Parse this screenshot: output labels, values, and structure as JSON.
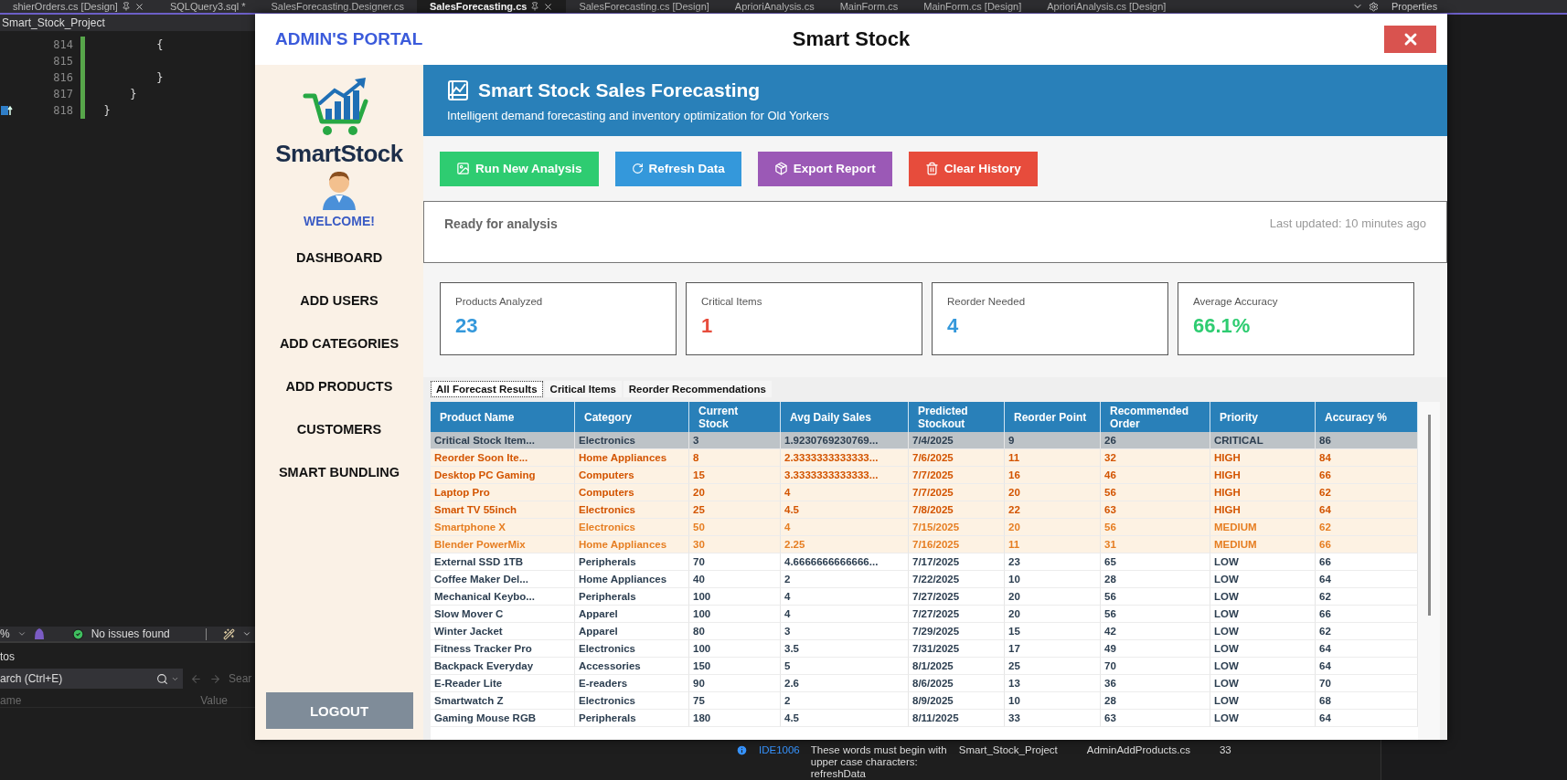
{
  "ide": {
    "tabs": [
      {
        "label": "shierOrders.cs [Design]",
        "selected": false,
        "pinned": true
      },
      {
        "label": "SQLQuery3.sql *",
        "selected": false,
        "pinned": false
      },
      {
        "label": "SalesForecasting.Designer.cs",
        "selected": false,
        "pinned": false
      },
      {
        "label": "SalesForecasting.cs",
        "selected": true,
        "pinned": true
      },
      {
        "label": "SalesForecasting.cs [Design]",
        "selected": false,
        "pinned": false
      },
      {
        "label": "AprioriAnalysis.cs",
        "selected": false,
        "pinned": false
      },
      {
        "label": "MainForm.cs",
        "selected": false,
        "pinned": false
      },
      {
        "label": "MainForm.cs [Design]",
        "selected": false,
        "pinned": false
      },
      {
        "label": "AprioriAnalysis.cs [Design]",
        "selected": false,
        "pinned": false
      }
    ],
    "panel_title": "Properties",
    "project": "Smart_Stock_Project",
    "code_lines": [
      {
        "number": "814",
        "text": "          {",
        "marker": false
      },
      {
        "number": "815",
        "marker": false
      },
      {
        "number": "816",
        "text": "          }",
        "marker": false
      },
      {
        "number": "817",
        "text": "      }",
        "marker": false
      },
      {
        "number": "818",
        "text": "  }",
        "marker": true
      }
    ],
    "status_bar": {
      "zoom": "%",
      "issues": "No issues found"
    },
    "locals": {
      "title": "tos",
      "search_placeholder": "arch (Ctrl+E)",
      "nav_hint": "Sear",
      "columns": [
        "ame",
        "Value"
      ]
    },
    "error_list": [
      {
        "code": "IDE1006",
        "description": "These words must begin with upper case characters: refreshData",
        "project": "Smart_Stock_Project",
        "file": "AdminAddProducts.cs",
        "line": "33"
      }
    ]
  },
  "app": {
    "portal_title": "ADMIN'S PORTAL",
    "title": "Smart Stock",
    "sidebar": {
      "brand": "SmartStock",
      "welcome": "WELCOME!",
      "items": [
        "DASHBOARD",
        "ADD USERS",
        "ADD CATEGORIES",
        "ADD PRODUCTS",
        "CUSTOMERS",
        "SMART BUNDLING"
      ],
      "logout": "LOGOUT"
    },
    "header": {
      "title": "Smart Stock Sales Forecasting",
      "subtitle": "Intelligent demand forecasting and inventory optimization for Old Yorkers"
    },
    "actions": [
      {
        "label": "Run New Analysis",
        "color": "#2ecc71"
      },
      {
        "label": "Refresh Data",
        "color": "#3498db"
      },
      {
        "label": "Export Report",
        "color": "#9b59b6"
      },
      {
        "label": "Clear History",
        "color": "#e74c3c"
      }
    ],
    "status": {
      "message": "Ready for analysis",
      "updated": "Last updated: 10 minutes ago"
    },
    "stats": [
      {
        "label": "Products Analyzed",
        "value": "23",
        "color": "#3498db"
      },
      {
        "label": "Critical Items",
        "value": "1",
        "color": "#e74c3c"
      },
      {
        "label": "Reorder Needed",
        "value": "4",
        "color": "#3498db"
      },
      {
        "label": "Average Accuracy",
        "value": "66.1%",
        "color": "#2ecc71"
      }
    ],
    "tabs": [
      {
        "label": "All Forecast Results",
        "selected": true
      },
      {
        "label": "Critical Items",
        "selected": false
      },
      {
        "label": "Reorder Recommendations",
        "selected": false
      }
    ],
    "table": {
      "columns": [
        "Product Name",
        "Category",
        "Current Stock",
        "Avg Daily Sales",
        "Predicted Stockout",
        "Reorder Point",
        "Recommended Order",
        "Priority",
        "Accuracy %"
      ],
      "rows": [
        {
          "kind": "critical",
          "selected": true,
          "cells": [
            "Critical Stock Item...",
            "Electronics",
            "3",
            "1.9230769230769...",
            "7/4/2025",
            "9",
            "26",
            "CRITICAL",
            "86"
          ]
        },
        {
          "kind": "high",
          "selected": false,
          "cells": [
            "Reorder Soon Ite...",
            "Home Appliances",
            "8",
            "2.3333333333333...",
            "7/6/2025",
            "11",
            "32",
            "HIGH",
            "84"
          ]
        },
        {
          "kind": "high",
          "selected": false,
          "cells": [
            "Desktop PC Gaming",
            "Computers",
            "15",
            "3.3333333333333...",
            "7/7/2025",
            "16",
            "46",
            "HIGH",
            "66"
          ]
        },
        {
          "kind": "high",
          "selected": false,
          "cells": [
            "Laptop Pro",
            "Computers",
            "20",
            "4",
            "7/7/2025",
            "20",
            "56",
            "HIGH",
            "62"
          ]
        },
        {
          "kind": "high",
          "selected": false,
          "cells": [
            "Smart TV 55inch",
            "Electronics",
            "25",
            "4.5",
            "7/8/2025",
            "22",
            "63",
            "HIGH",
            "64"
          ]
        },
        {
          "kind": "medium",
          "selected": false,
          "cells": [
            "Smartphone X",
            "Electronics",
            "50",
            "4",
            "7/15/2025",
            "20",
            "56",
            "MEDIUM",
            "62"
          ]
        },
        {
          "kind": "medium",
          "selected": false,
          "cells": [
            "Blender PowerMix",
            "Home Appliances",
            "30",
            "2.25",
            "7/16/2025",
            "11",
            "31",
            "MEDIUM",
            "66"
          ]
        },
        {
          "kind": "low",
          "selected": false,
          "cells": [
            "External SSD 1TB",
            "Peripherals",
            "70",
            "4.6666666666666...",
            "7/17/2025",
            "23",
            "65",
            "LOW",
            "66"
          ]
        },
        {
          "kind": "low",
          "selected": false,
          "cells": [
            "Coffee Maker Del...",
            "Home Appliances",
            "40",
            "2",
            "7/22/2025",
            "10",
            "28",
            "LOW",
            "64"
          ]
        },
        {
          "kind": "low",
          "selected": false,
          "cells": [
            "Mechanical Keybo...",
            "Peripherals",
            "100",
            "4",
            "7/27/2025",
            "20",
            "56",
            "LOW",
            "62"
          ]
        },
        {
          "kind": "low",
          "selected": false,
          "cells": [
            "Slow Mover C",
            "Apparel",
            "100",
            "4",
            "7/27/2025",
            "20",
            "56",
            "LOW",
            "66"
          ]
        },
        {
          "kind": "low",
          "selected": false,
          "cells": [
            "Winter Jacket",
            "Apparel",
            "80",
            "3",
            "7/29/2025",
            "15",
            "42",
            "LOW",
            "62"
          ]
        },
        {
          "kind": "low",
          "selected": false,
          "cells": [
            "Fitness Tracker Pro",
            "Electronics",
            "100",
            "3.5",
            "7/31/2025",
            "17",
            "49",
            "LOW",
            "64"
          ]
        },
        {
          "kind": "low",
          "selected": false,
          "cells": [
            "Backpack Everyday",
            "Accessories",
            "150",
            "5",
            "8/1/2025",
            "25",
            "70",
            "LOW",
            "64"
          ]
        },
        {
          "kind": "low",
          "selected": false,
          "cells": [
            "E-Reader Lite",
            "E-readers",
            "90",
            "2.6",
            "8/6/2025",
            "13",
            "36",
            "LOW",
            "70"
          ]
        },
        {
          "kind": "low",
          "selected": false,
          "cells": [
            "Smartwatch Z",
            "Electronics",
            "75",
            "2",
            "8/9/2025",
            "10",
            "28",
            "LOW",
            "68"
          ]
        },
        {
          "kind": "low",
          "selected": false,
          "cells": [
            "Gaming Mouse RGB",
            "Peripherals",
            "180",
            "4.5",
            "8/11/2025",
            "33",
            "63",
            "LOW",
            "64"
          ]
        }
      ]
    }
  }
}
